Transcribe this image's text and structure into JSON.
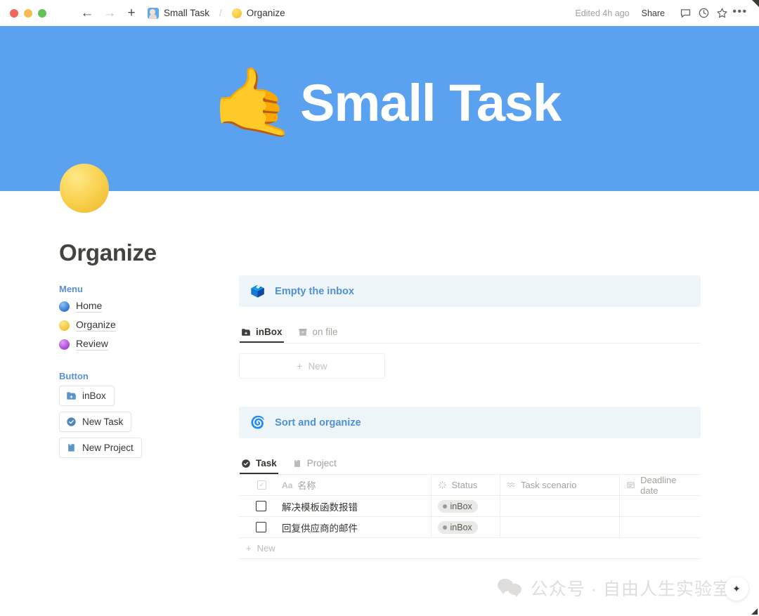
{
  "titlebar": {
    "window_controls": [
      "close",
      "minimize",
      "maximize"
    ],
    "menu_icon": "hamburger-icon",
    "back_glyph": "←",
    "forward_glyph": "→",
    "new_glyph": "+",
    "breadcrumb": {
      "workspace_icon": "memoji-avatar-icon",
      "workspace": "Small Task",
      "separator": "/",
      "page_icon": "🟡",
      "page": "Organize"
    },
    "edited": "Edited 4h ago",
    "share": "Share",
    "comment_icon": "comment-icon",
    "history_icon": "clock-icon",
    "favorite_icon": "star-icon",
    "more_glyph": "•••"
  },
  "hero": {
    "emoji": "🤙",
    "title": "Small Task",
    "background": "#5aa2f0"
  },
  "page": {
    "icon": "🟡",
    "title": "Organize"
  },
  "sidebar": {
    "menu_heading": "Menu",
    "menu_items": [
      {
        "label": "Home",
        "bullet": "blue"
      },
      {
        "label": "Organize",
        "bullet": "yellow"
      },
      {
        "label": "Review",
        "bullet": "purple"
      }
    ],
    "button_heading": "Button",
    "buttons": [
      {
        "label": "inBox",
        "icon": "folder-add-icon"
      },
      {
        "label": "New Task",
        "icon": "check-circle-icon"
      },
      {
        "label": "New Project",
        "icon": "notebook-icon"
      }
    ]
  },
  "main": {
    "section1": {
      "callout_emoji": "🗳️",
      "callout_text": "Empty the inbox",
      "tabs": [
        {
          "label": "inBox",
          "icon": "folder-add-icon",
          "active": true
        },
        {
          "label": "on file",
          "icon": "archive-icon",
          "active": false
        }
      ],
      "new_button": "New",
      "new_glyph": "+"
    },
    "section2": {
      "callout_emoji": "🌀",
      "callout_text": "Sort and organize",
      "tabs": [
        {
          "label": "Task",
          "icon": "check-circle-icon",
          "active": true
        },
        {
          "label": "Project",
          "icon": "notebook-icon",
          "active": false
        }
      ],
      "table": {
        "columns": [
          {
            "label": "",
            "icon": "checkbox-icon"
          },
          {
            "label": "名称",
            "icon": "aa-text-icon"
          },
          {
            "label": "Status",
            "icon": "loading-icon"
          },
          {
            "label": "Task scenario",
            "icon": "wave-icon"
          },
          {
            "label": "Deadline date",
            "icon": "calendar-icon"
          }
        ],
        "rows": [
          {
            "checked": false,
            "name": "解决模板函数报错",
            "status": "inBox",
            "scenario": "",
            "deadline": ""
          },
          {
            "checked": false,
            "name": "回复供应商的邮件",
            "status": "inBox",
            "scenario": "",
            "deadline": ""
          }
        ],
        "new_row": "New",
        "new_glyph": "+"
      }
    }
  },
  "watermark": {
    "icon": "wechat-icon",
    "text": "公众号 · 自由人生实验室"
  },
  "ai_button": {
    "icon": "sparkles-icon",
    "glyph": "✦"
  },
  "colors": {
    "hero_blue": "#5aa2f0",
    "accent_blue": "#4f8fd4",
    "callout_bg": "#eef5f9",
    "text": "#37352f",
    "muted": "#a5a29c"
  }
}
